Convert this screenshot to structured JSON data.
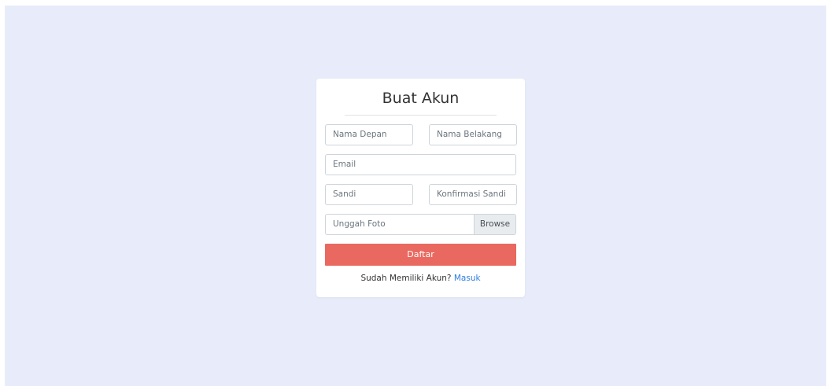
{
  "form": {
    "title": "Buat Akun",
    "first_name_placeholder": "Nama Depan",
    "last_name_placeholder": "Nama Belakang",
    "email_placeholder": "Email",
    "password_placeholder": "Sandi",
    "confirm_password_placeholder": "Konfirmasi Sandi",
    "upload_label": "Unggah Foto",
    "browse_label": "Browse",
    "submit_label": "Daftar",
    "login_prompt": "Sudah Memiliki Akun?",
    "login_link": "Masuk"
  },
  "colors": {
    "background": "#e8ecfa",
    "card": "#ffffff",
    "submit_button": "#e9685f",
    "link": "#2f7fe0"
  }
}
